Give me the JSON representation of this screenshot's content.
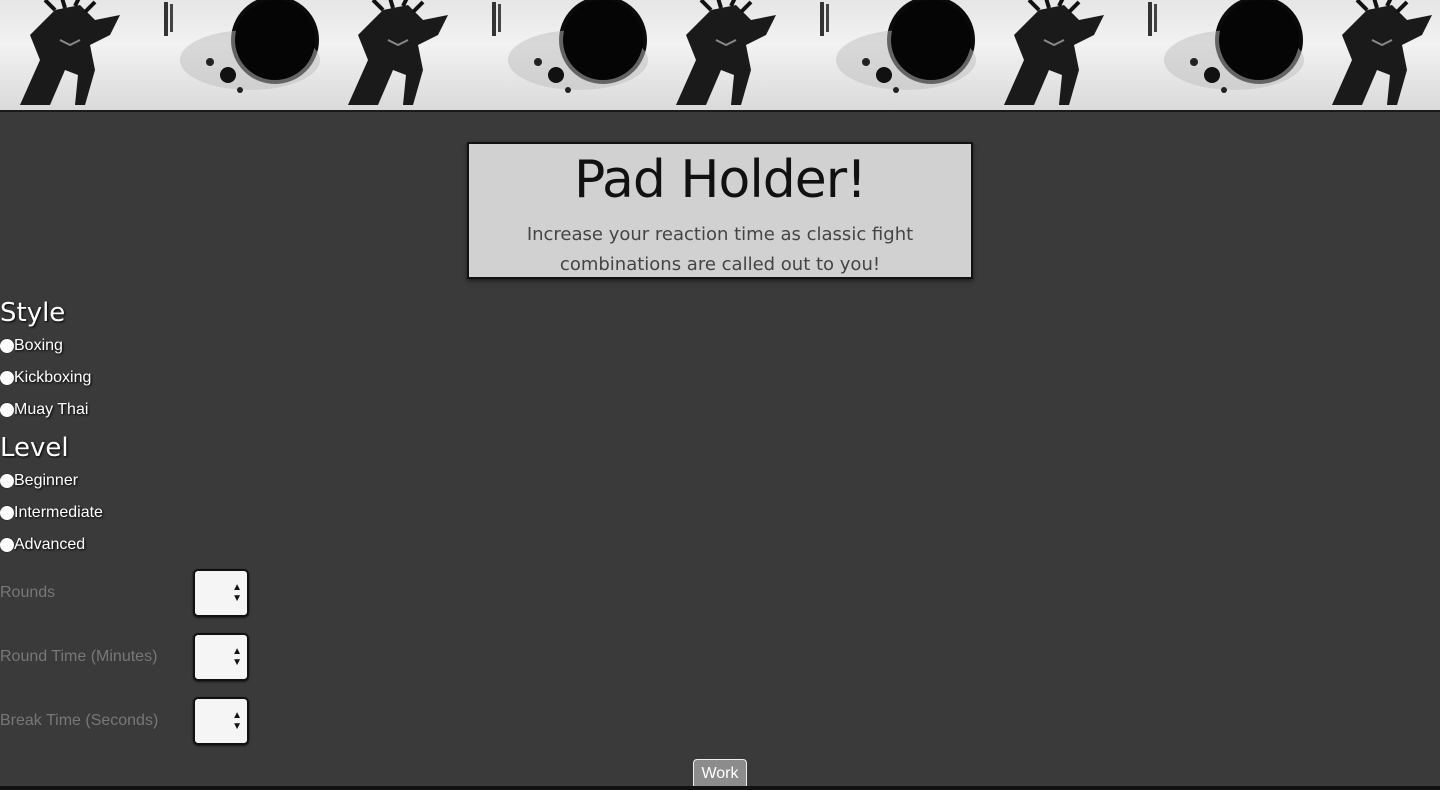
{
  "banner": {
    "image": "ink-wash-warrior-artwork",
    "tile_count": 5
  },
  "hero": {
    "title": "Pad Holder!",
    "subtitle": "Increase your reaction time as classic fight combinations are called out to you!"
  },
  "style_group": {
    "heading": "Style",
    "options": [
      "Boxing",
      "Kickboxing",
      "Muay Thai"
    ]
  },
  "level_group": {
    "heading": "Level",
    "options": [
      "Beginner",
      "Intermediate",
      "Advanced"
    ]
  },
  "settings": {
    "rounds_label": "Rounds",
    "round_time_label": "Round Time (Minutes)",
    "break_time_label": "Break Time (Seconds)"
  },
  "actions": {
    "work_label": "Work"
  },
  "colors": {
    "background": "#3a3a3a",
    "hero_bg": "#d1d1d1",
    "button_bg": "#8c8c8c"
  }
}
